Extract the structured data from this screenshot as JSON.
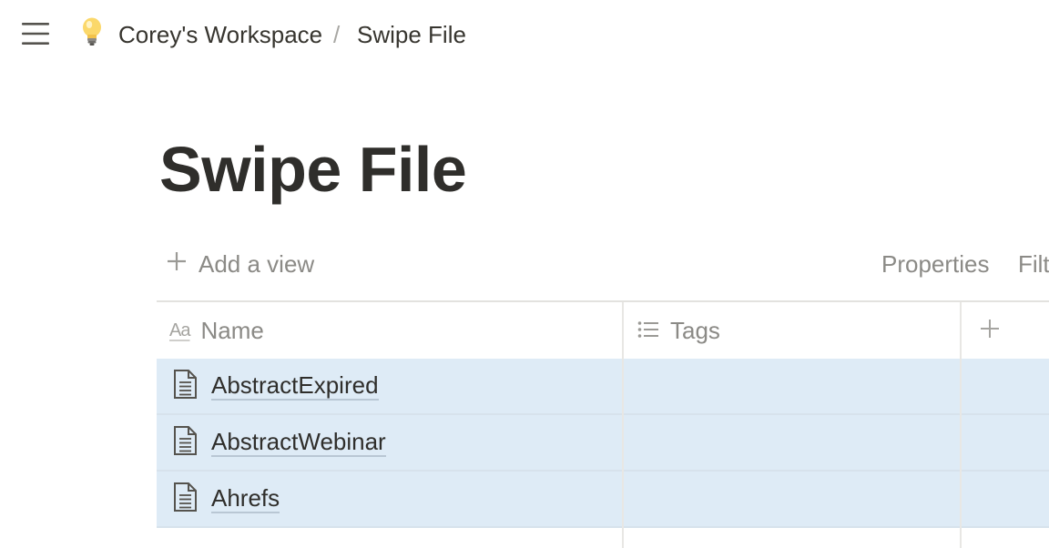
{
  "breadcrumb": {
    "workspace": "Corey's Workspace",
    "separator": "/",
    "page": "Swipe File"
  },
  "page": {
    "title": "Swipe File"
  },
  "view_bar": {
    "add_view_label": "Add a view",
    "properties_label": "Properties",
    "filter_label": "Filt"
  },
  "table": {
    "columns": [
      {
        "label": "Name",
        "icon": "text-property-icon",
        "icon_text": "Aa"
      },
      {
        "label": "Tags",
        "icon": "list-icon"
      }
    ],
    "add_column_icon": "plus-icon",
    "rows": [
      {
        "name": "AbstractExpired",
        "tags": ""
      },
      {
        "name": "AbstractWebinar",
        "tags": ""
      },
      {
        "name": "Ahrefs",
        "tags": ""
      }
    ],
    "selected_row_color": "#deebf6"
  },
  "icons": {
    "menu": "hamburger-menu-icon",
    "workspace": "lightbulb-icon",
    "page": "document-icon"
  }
}
